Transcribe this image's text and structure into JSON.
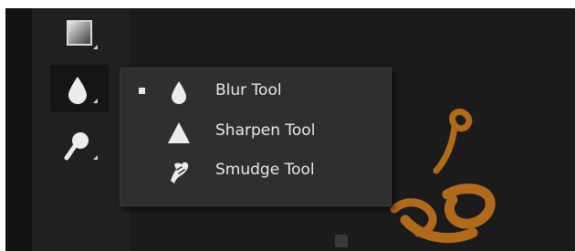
{
  "toolbar": {
    "tools": [
      {
        "name": "gradient-tool",
        "icon": "gradient-icon"
      },
      {
        "name": "blur-tool",
        "icon": "drop-icon",
        "selected": true
      },
      {
        "name": "dodge-tool",
        "icon": "dodge-icon"
      }
    ]
  },
  "flyout": {
    "items": [
      {
        "label": "Blur Tool",
        "icon": "drop-icon",
        "active": true
      },
      {
        "label": "Sharpen Tool",
        "icon": "triangle-icon",
        "active": false
      },
      {
        "label": "Smudge Tool",
        "icon": "finger-icon",
        "active": false
      }
    ]
  },
  "colors": {
    "canvas": "#1b1b1b",
    "toolbar": "#202020",
    "flyout": "#2f2f2f",
    "menu_text": "#e8e8e8",
    "artwork": "#b06a1c"
  }
}
